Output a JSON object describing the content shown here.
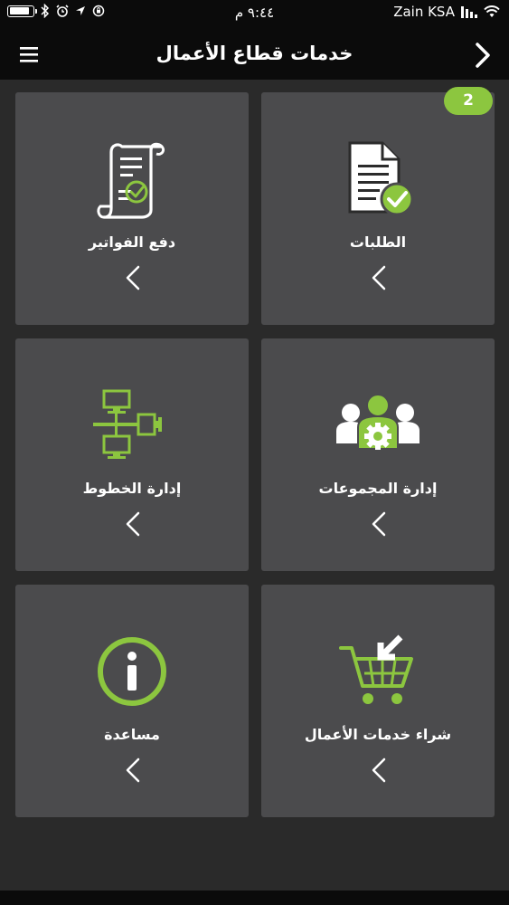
{
  "status_bar": {
    "time": "٩:٤٤ م",
    "carrier": "Zain KSA",
    "battery_level": 0.9
  },
  "header": {
    "title": "خدمات قطاع الأعمال",
    "menu_icon": "hamburger-icon",
    "back_icon": "chevron-right-icon"
  },
  "tiles": [
    {
      "label": "الطلبات",
      "icon": "document-check-icon",
      "badge": "2"
    },
    {
      "label": "دفع الفواتير",
      "icon": "invoice-scroll-check-icon"
    },
    {
      "label": "إدارة المجموعات",
      "icon": "group-users-gear-icon"
    },
    {
      "label": "إدارة الخطوط",
      "icon": "network-monitors-icon"
    },
    {
      "label": "شراء خدمات الأعمال",
      "icon": "shopping-cart-arrow-icon"
    },
    {
      "label": "مساعدة",
      "icon": "info-circle-icon"
    }
  ],
  "colors": {
    "accent": "#8cc63f",
    "tile_bg": "#4b4b4d",
    "content_bg": "#2a2a2a",
    "header_bg": "#0b0b0b"
  }
}
